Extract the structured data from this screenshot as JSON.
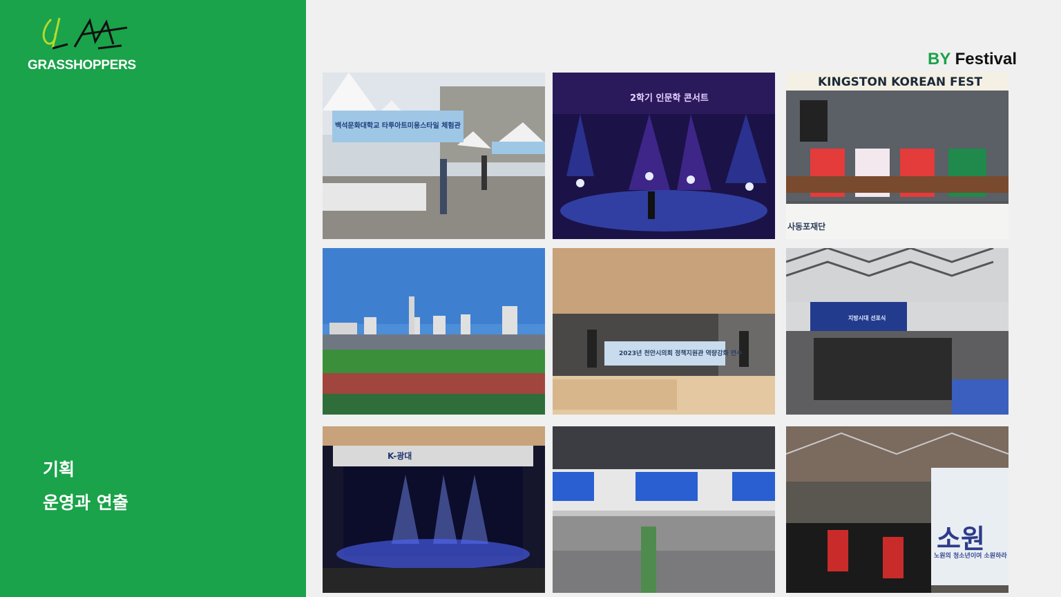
{
  "brand": {
    "logo_text": "GRASSHOPPERS"
  },
  "tagline": {
    "line1": "기획",
    "line2": "운영과 연출"
  },
  "heading": {
    "by": "BY",
    "rest": "Festival"
  },
  "photos": {
    "p1": {
      "banner": "백석문화대학교 타투아트미용스타일 체험관"
    },
    "p2": {
      "sign": "2학기 인문학 콘서트"
    },
    "p3": {
      "sign": "KINGSTON KOREAN FEST",
      "podium": "사동포재단"
    },
    "p5": {
      "banner": "2023년 천안시의회 정책지원관 역량강화 연수"
    },
    "p6": {
      "screen": "지방시대 선포식"
    },
    "p7": {
      "banner": "K-광대"
    },
    "p9": {
      "banner": "소원",
      "subtext": "노원의 청소년이여 소원하라"
    }
  },
  "colors": {
    "brand_green": "#1aa34a",
    "accent_lime": "#b6d92e"
  }
}
